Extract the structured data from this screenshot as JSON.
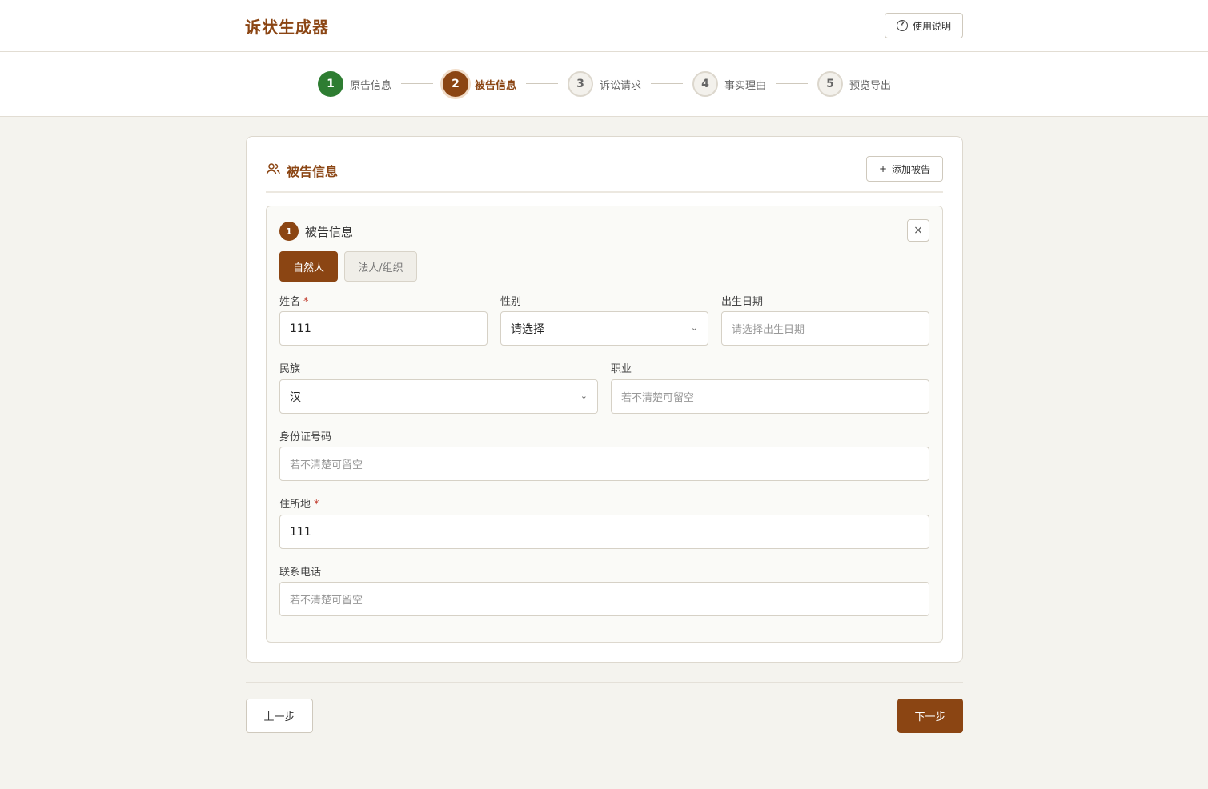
{
  "app": {
    "title": "诉状生成器",
    "help_label": "使用说明"
  },
  "steps": [
    {
      "num": "1",
      "label": "原告信息",
      "state": "done"
    },
    {
      "num": "2",
      "label": "被告信息",
      "state": "active"
    },
    {
      "num": "3",
      "label": "诉讼请求",
      "state": "todo"
    },
    {
      "num": "4",
      "label": "事实理由",
      "state": "todo"
    },
    {
      "num": "5",
      "label": "预览导出",
      "state": "todo"
    }
  ],
  "section": {
    "title": "被告信息",
    "add_label": "添加被告"
  },
  "defendant": {
    "num": "1",
    "title": "被告信息",
    "close": "×",
    "type_tabs": [
      "自然人",
      "法人/组织"
    ],
    "fields": {
      "name": {
        "label": "姓名",
        "required": "*",
        "value": "111"
      },
      "gender": {
        "label": "性别",
        "value": "请选择"
      },
      "birthdate": {
        "label": "出生日期",
        "placeholder": "请选择出生日期"
      },
      "ethnicity": {
        "label": "民族",
        "value": "汉"
      },
      "occupation": {
        "label": "职业",
        "placeholder": "若不清楚可留空"
      },
      "id_number": {
        "label": "身份证号码",
        "placeholder": "若不清楚可留空"
      },
      "address": {
        "label": "住所地",
        "required": "*",
        "value": "111"
      },
      "phone": {
        "label": "联系电话",
        "placeholder": "若不清楚可留空"
      }
    }
  },
  "nav": {
    "prev": "上一步",
    "next": "下一步"
  },
  "colors": {
    "brand": "#8b4513",
    "done": "#2e7d32",
    "required": "#c0392b"
  }
}
